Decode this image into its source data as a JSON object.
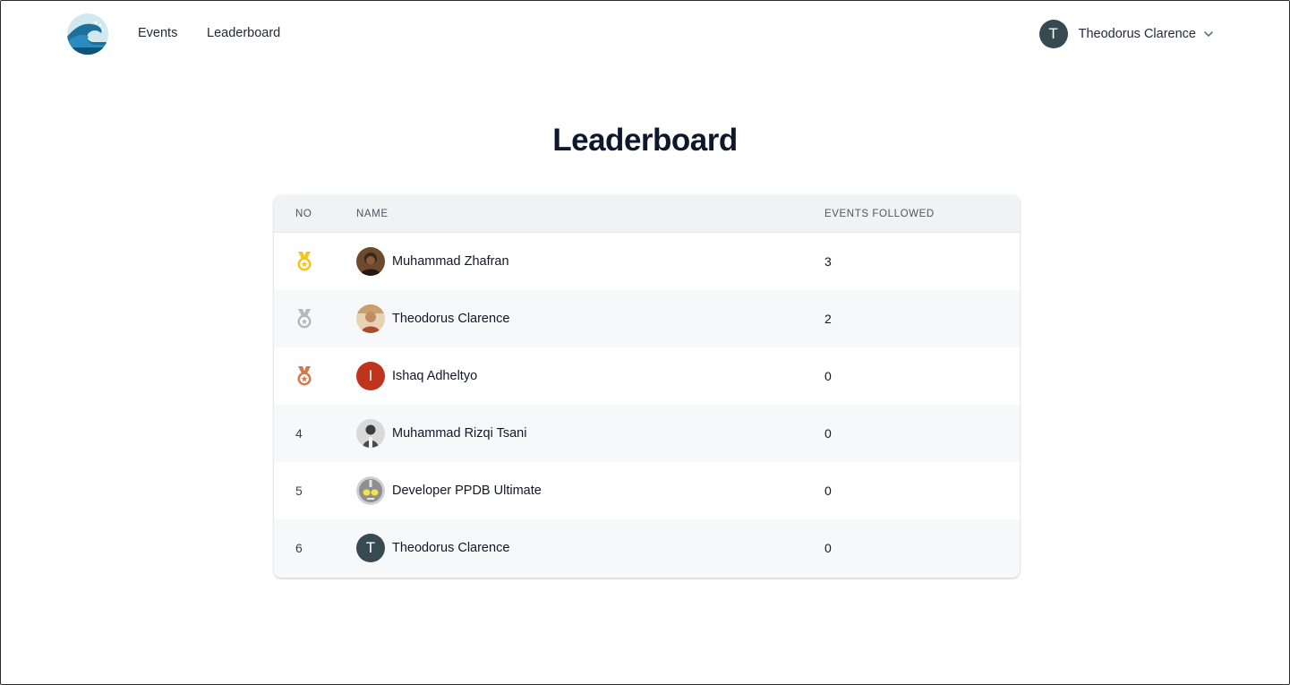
{
  "nav": {
    "links": [
      "Events",
      "Leaderboard"
    ],
    "user": {
      "initial": "T",
      "name": "Theodorus Clarence"
    }
  },
  "page": {
    "title": "Leaderboard"
  },
  "table": {
    "headers": {
      "no": "NO",
      "name": "NAME",
      "events": "EVENTS FOLLOWED"
    },
    "rows": [
      {
        "no": "1",
        "rank_icon": "gold-medal-icon",
        "name": "Muhammad Zhafran",
        "avatar_type": "photo",
        "events": "3"
      },
      {
        "no": "2",
        "rank_icon": "silver-medal-icon",
        "name": "Theodorus Clarence",
        "avatar_type": "photo",
        "events": "2"
      },
      {
        "no": "3",
        "rank_icon": "bronze-medal-icon",
        "name": "Ishaq Adheltyo",
        "avatar_type": "initial",
        "initial": "I",
        "avatar_color": "#c0341d",
        "events": "0"
      },
      {
        "no": "4",
        "name": "Muhammad Rizqi Tsani",
        "avatar_type": "photo",
        "events": "0"
      },
      {
        "no": "5",
        "name": "Developer PPDB Ultimate",
        "avatar_type": "photo",
        "events": "0"
      },
      {
        "no": "6",
        "name": "Theodorus Clarence",
        "avatar_type": "initial",
        "initial": "T",
        "avatar_color": "#374951",
        "events": "0"
      }
    ]
  },
  "colors": {
    "gold": "#f5c518",
    "silver": "#b8b8b8",
    "bronze": "#d27a4a",
    "avatar_dark": "#374951"
  }
}
